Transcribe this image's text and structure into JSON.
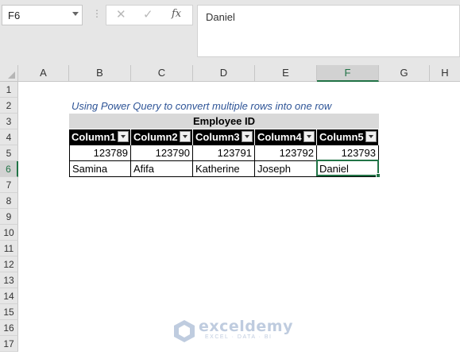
{
  "name_box": {
    "value": "F6"
  },
  "formula_bar": {
    "value": "Daniel",
    "fx_label": "fx",
    "cancel_glyph": "✕",
    "enter_glyph": "✓"
  },
  "columns": [
    "A",
    "B",
    "C",
    "D",
    "E",
    "F",
    "G",
    "H"
  ],
  "rows": [
    "1",
    "2",
    "3",
    "4",
    "5",
    "6",
    "7",
    "8",
    "9",
    "10",
    "11",
    "12",
    "13",
    "14",
    "15",
    "16",
    "17"
  ],
  "active_cell": {
    "column": "F",
    "row": "6"
  },
  "sheet": {
    "title": "Using Power Query to convert multiple rows into one row",
    "band_header": "Employee ID",
    "table_headers": [
      "Column1",
      "Column2",
      "Column3",
      "Column4",
      "Column5"
    ],
    "ids": [
      "123789",
      "123790",
      "123791",
      "123792",
      "123793"
    ],
    "names": [
      "Samina",
      "Afifa",
      "Katherine",
      "Joseph",
      "Daniel"
    ]
  },
  "watermark": {
    "name": "exceldemy",
    "tagline": "EXCEL · DATA · BI"
  },
  "colors": {
    "accent": "#217346",
    "title_text": "#2f5597",
    "table_header_bg": "#000000",
    "band_bg": "#d9d9d9"
  }
}
